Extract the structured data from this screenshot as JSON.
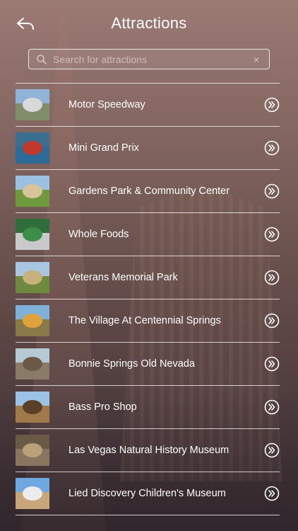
{
  "header": {
    "title": "Attractions",
    "back_icon": "back-arrow-icon"
  },
  "search": {
    "placeholder": "Search for attractions",
    "value": "",
    "clear_glyph": "×"
  },
  "colors": {
    "text": "#ffffff",
    "divider": "#ffffff"
  },
  "attractions": [
    {
      "label": "Motor Speedway",
      "thumb": {
        "sky": "#8fb4d8",
        "ground": "#7f8d6a",
        "blob": "#d9d9d9"
      }
    },
    {
      "label": "Mini Grand Prix",
      "thumb": {
        "sky": "#3b6f8f",
        "ground": "#2c6a99",
        "blob": "#c0392b"
      }
    },
    {
      "label": "Gardens Park & Community Center",
      "thumb": {
        "sky": "#9cc0e0",
        "ground": "#6e9a3c",
        "blob": "#d7c49a"
      }
    },
    {
      "label": "Whole Foods",
      "thumb": {
        "sky": "#2f6e3a",
        "ground": "#c9c9c9",
        "blob": "#3c8c4a"
      }
    },
    {
      "label": "Veterans Memorial Park",
      "thumb": {
        "sky": "#a9c6e0",
        "ground": "#6f8a3f",
        "blob": "#c7b07a"
      }
    },
    {
      "label": "The Village At Centennial Springs",
      "thumb": {
        "sky": "#7fb0d8",
        "ground": "#8a7a4a",
        "blob": "#e0a33a"
      }
    },
    {
      "label": "Bonnie Springs Old Nevada",
      "thumb": {
        "sky": "#b8c9d6",
        "ground": "#8a7a68",
        "blob": "#6b5a48"
      }
    },
    {
      "label": "Bass Pro Shop",
      "thumb": {
        "sky": "#9cc3e6",
        "ground": "#a07a4a",
        "blob": "#5a4028"
      }
    },
    {
      "label": "Las Vegas Natural History Museum",
      "thumb": {
        "sky": "#6a5a45",
        "ground": "#8a7560",
        "blob": "#b9a27a"
      }
    },
    {
      "label": "Lied Discovery Children's Museum",
      "thumb": {
        "sky": "#6fa8e0",
        "ground": "#c9a67a",
        "blob": "#ececec"
      }
    }
  ]
}
